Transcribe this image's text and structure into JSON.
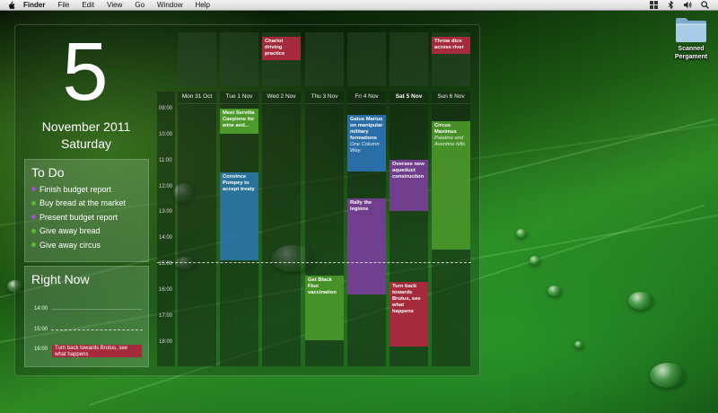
{
  "menubar": {
    "items": [
      "Finder",
      "File",
      "Edit",
      "View",
      "Go",
      "Window",
      "Help"
    ]
  },
  "desktop": {
    "folder_label": "Scanned Pergament"
  },
  "date": {
    "day": "5",
    "month_year": "November 2011",
    "weekday": "Saturday"
  },
  "todo": {
    "title": "To Do",
    "items": [
      {
        "label": "Finish budget report",
        "color": "#a050c8"
      },
      {
        "label": "Buy bread at the market",
        "color": "#5fb832"
      },
      {
        "label": "Present budget report",
        "color": "#a050c8"
      },
      {
        "label": "Give away bread",
        "color": "#5fb832"
      },
      {
        "label": "Give away circus",
        "color": "#5fb832"
      }
    ]
  },
  "right_now": {
    "title": "Right Now",
    "times": [
      "14:00",
      "15:00",
      "16:00"
    ],
    "event": "Turn back towards Brutus, see what happens"
  },
  "calendar": {
    "days": [
      "Mon 31 Oct",
      "Tue 1 Nov",
      "Wed 2 Nov",
      "Thu 3 Nov",
      "Fri 4 Nov",
      "Sat 5 Nov",
      "Sun 6 Nov"
    ],
    "hours": [
      "09:00",
      "10:00",
      "11:00",
      "12:00",
      "13:00",
      "14:00",
      "15:00",
      "16:00",
      "17:00",
      "18:00"
    ],
    "allday_events": [
      {
        "title": "Chariot driving practice",
        "color": "#a52a3c"
      },
      {
        "title": "Throw dice across river",
        "color": "#a52a3c"
      }
    ],
    "events": [
      {
        "title": "Meet Servilia Caepione for wine and...",
        "sub": "",
        "color": "#4c9a2a"
      },
      {
        "title": "Convince Pompey to accept treaty",
        "sub": "",
        "color": "#2a78a8"
      },
      {
        "title": "Gaius Marius on manipular military formations",
        "sub": "One Column Way",
        "color": "#2a6ea8"
      },
      {
        "title": "Rally the legions",
        "sub": "",
        "color": "#7a3e9a"
      },
      {
        "title": "Get Black Flux vaccination",
        "sub": "",
        "color": "#4c9a2a"
      },
      {
        "title": "Oversee new aqueduct construction",
        "sub": "",
        "color": "#7a3e9a"
      },
      {
        "title": "Turn back towards Brutus, see what happens",
        "sub": "",
        "color": "#a52a3c"
      },
      {
        "title": "Circus Maximus",
        "sub": "Palatine and Aventine hills",
        "color": "#4c9a2a"
      }
    ]
  }
}
